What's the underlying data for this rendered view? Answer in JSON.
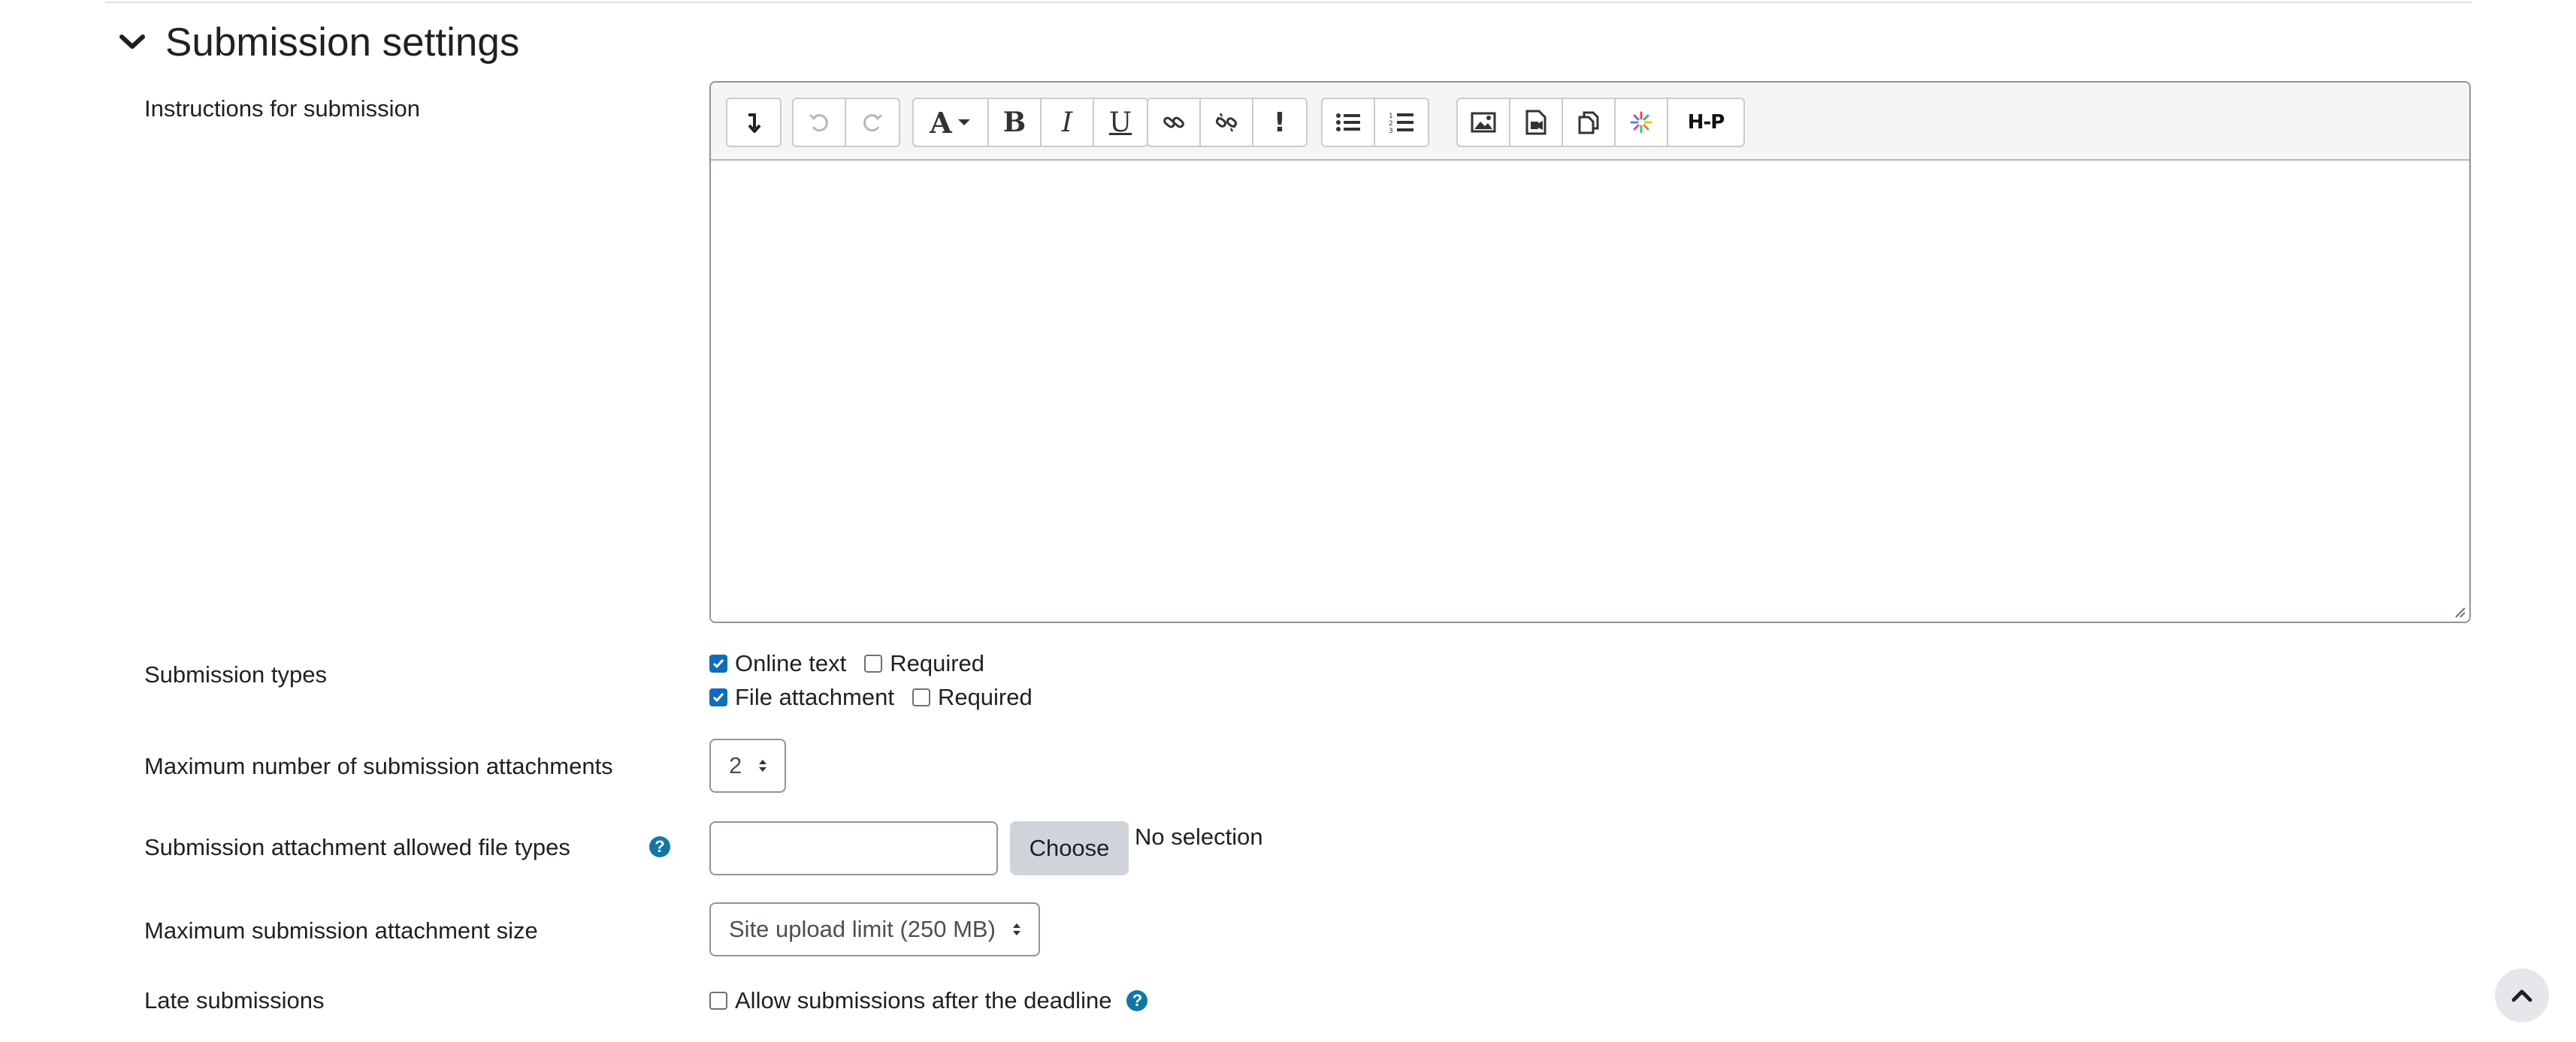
{
  "section": {
    "title": "Submission settings",
    "collapse_icon": "chevron-down-icon"
  },
  "instructions": {
    "label": "Instructions for submission",
    "toolbar": {
      "groups": [
        [
          "show-more-icon"
        ],
        [
          "undo-icon",
          "redo-icon"
        ],
        [
          "font-style-icon",
          "bold-icon",
          "italic-icon",
          "underline-icon"
        ],
        [
          "link-icon",
          "unlink-icon",
          "emphasis-icon"
        ],
        [
          "bullet-list-icon",
          "numbered-list-icon"
        ],
        [
          "image-icon",
          "media-icon",
          "manage-files-icon",
          "recording-icon",
          "h5p-icon"
        ]
      ],
      "bold_glyph": "B",
      "italic_glyph": "I",
      "underline_glyph": "U",
      "emphasis_glyph": "!",
      "font_glyph": "A",
      "h5p_glyph": "H-P"
    }
  },
  "submission_types": {
    "label": "Submission types",
    "online_text": {
      "label": "Online text",
      "checked": true
    },
    "online_text_required": {
      "label": "Required",
      "checked": false
    },
    "file_attachment": {
      "label": "File attachment",
      "checked": true
    },
    "file_attachment_required": {
      "label": "Required",
      "checked": false
    }
  },
  "max_attachments": {
    "label": "Maximum number of submission attachments",
    "value": "2"
  },
  "allowed_file_types": {
    "label": "Submission attachment allowed file types",
    "value": "",
    "choose_label": "Choose",
    "selection_text": "No selection"
  },
  "max_attachment_size": {
    "label": "Maximum submission attachment size",
    "value": "Site upload limit (250 MB)"
  },
  "late_submissions": {
    "label": "Late submissions",
    "allow_label": "Allow submissions after the deadline",
    "checked": false
  },
  "colors": {
    "accent": "#0f6cbf",
    "help": "#1177a6",
    "button_bg": "#ced4da"
  }
}
